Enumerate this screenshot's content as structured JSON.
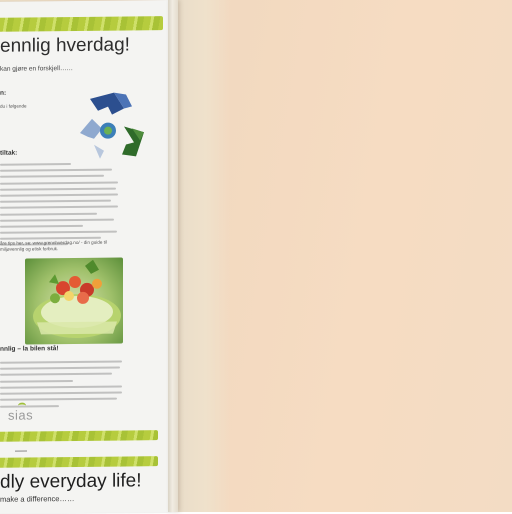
{
  "poster": {
    "title_no": "ennlig hverdag!",
    "subtitle_no": "kan gjøre en forskjell……",
    "section_head_1": "n:",
    "section_small_1": "du i følgende",
    "section_head_2": "tiltak:",
    "web_note": "åre tips her, se: www.grennhverdag.no/ - din guide til",
    "web_note_2": "miljøvennlig og etisk forbruk.",
    "section_head_3": "nnlig – la bilen stå!",
    "logo_text": "sias",
    "title_en": "dly everyday life!",
    "subtitle_en": "make a difference……"
  },
  "colors": {
    "stripe_green": "#b6cc3e",
    "wall": "#f4dcc2",
    "poster_bg": "#f4f4f2"
  }
}
